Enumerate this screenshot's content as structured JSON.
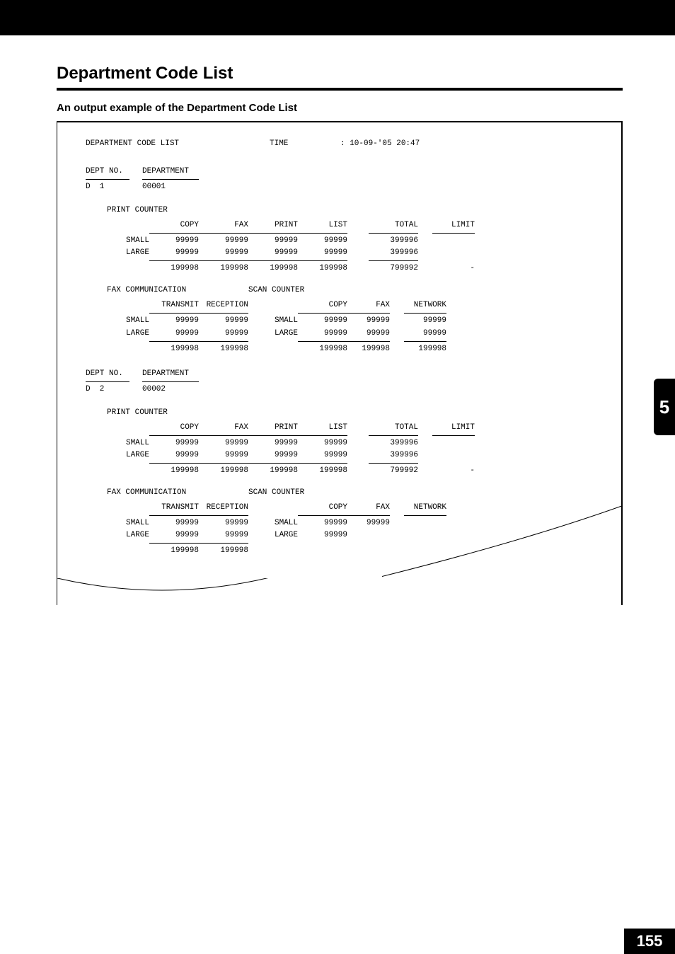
{
  "page_title": "Department Code List",
  "subtitle": "An output example of the Department Code List",
  "side_tab": "5",
  "page_number": "155",
  "report": {
    "title": "DEPARTMENT CODE LIST",
    "time_label": "TIME",
    "time_value": ": 10-09-'05 20:47",
    "dept_no_label": "DEPT NO.",
    "dept_label": "DEPARTMENT",
    "print_counter_label": "PRINT COUNTER",
    "fax_comm_label": "FAX COMMUNICATION",
    "scan_counter_label": "SCAN COUNTER",
    "row_labels": {
      "small": "SMALL",
      "large": "LARGE"
    },
    "print_headers": [
      "COPY",
      "FAX",
      "PRINT",
      "LIST",
      "TOTAL",
      "LIMIT"
    ],
    "fax_headers": [
      "TRANSMIT",
      "RECEPTION"
    ],
    "scan_headers": [
      "COPY",
      "FAX",
      "NETWORK"
    ],
    "departments": [
      {
        "dept_no": "D  1",
        "department": "00001",
        "print": {
          "small": {
            "copy": "99999",
            "fax": "99999",
            "print": "99999",
            "list": "99999",
            "total": "399996"
          },
          "large": {
            "copy": "99999",
            "fax": "99999",
            "print": "99999",
            "list": "99999",
            "total": "399996"
          },
          "totals": {
            "copy": "199998",
            "fax": "199998",
            "print": "199998",
            "list": "199998",
            "total": "799992",
            "limit": "-"
          }
        },
        "faxcomm": {
          "small": {
            "transmit": "99999",
            "reception": "99999"
          },
          "large": {
            "transmit": "99999",
            "reception": "99999"
          },
          "totals": {
            "transmit": "199998",
            "reception": "199998"
          }
        },
        "scan": {
          "small": {
            "copy": "99999",
            "fax": "99999",
            "network": "99999"
          },
          "large": {
            "copy": "99999",
            "fax": "99999",
            "network": "99999"
          },
          "totals": {
            "copy": "199998",
            "fax": "199998",
            "network": "199998"
          }
        }
      },
      {
        "dept_no": "D  2",
        "department": "00002",
        "print": {
          "small": {
            "copy": "99999",
            "fax": "99999",
            "print": "99999",
            "list": "99999",
            "total": "399996"
          },
          "large": {
            "copy": "99999",
            "fax": "99999",
            "print": "99999",
            "list": "99999",
            "total": "399996"
          },
          "totals": {
            "copy": "199998",
            "fax": "199998",
            "print": "199998",
            "list": "199998",
            "total": "799992",
            "limit": "-"
          }
        },
        "faxcomm": {
          "small": {
            "transmit": "99999",
            "reception": "99999"
          },
          "large": {
            "transmit": "99999",
            "reception": "99999"
          },
          "totals": {
            "transmit": "199998",
            "reception": "199998"
          }
        },
        "scan": {
          "small": {
            "copy": "99999",
            "fax": "99999"
          },
          "large": {
            "copy": "99999"
          }
        }
      }
    ]
  }
}
